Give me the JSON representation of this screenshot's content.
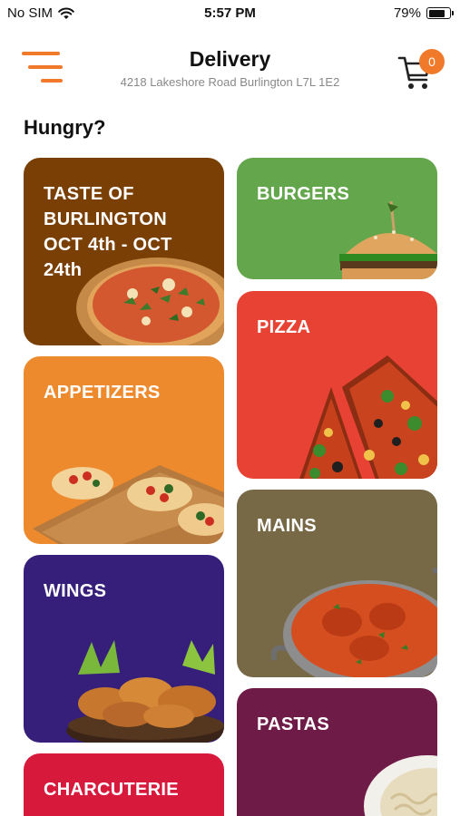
{
  "status_bar": {
    "carrier": "No SIM",
    "time": "5:57 PM",
    "battery": "79%",
    "battery_level": 0.79
  },
  "header": {
    "title": "Delivery",
    "address": "4218 Lakeshore Road   Burlington L7L 1E2",
    "cart_count": "0"
  },
  "main": {
    "heading": "Hungry?",
    "categories": [
      {
        "label": "TASTE OF BURLINGTON OCT 4th - OCT 24th",
        "color": "#7a3f05"
      },
      {
        "label": "BURGERS",
        "color": "#64a64b"
      },
      {
        "label": "PIZZA",
        "color": "#e84234"
      },
      {
        "label": "APPETIZERS",
        "color": "#ee8a2e"
      },
      {
        "label": "MAINS",
        "color": "#786946"
      },
      {
        "label": "WINGS",
        "color": "#351f7a"
      },
      {
        "label": "PASTAS",
        "color": "#6f1b47"
      },
      {
        "label": "CHARCUTERIE",
        "color": "#d7193c"
      }
    ]
  },
  "icons": {
    "menu": "menu-icon",
    "cart": "cart-icon",
    "wifi": "wifi-icon",
    "battery": "battery-icon"
  },
  "accent_color": "#f07a2a"
}
